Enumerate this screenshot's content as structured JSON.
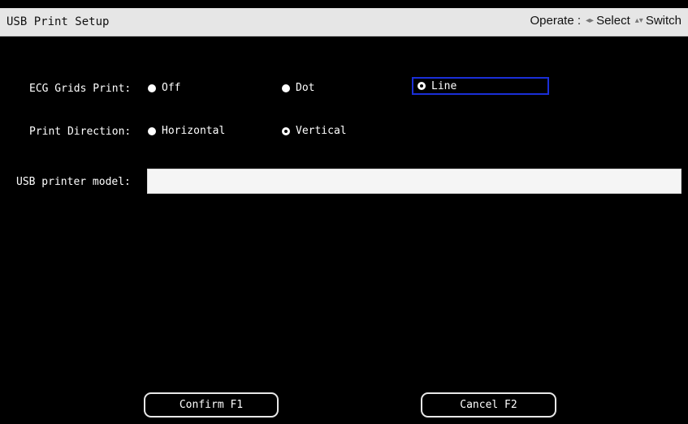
{
  "window": {
    "title": "USB Print Setup",
    "operate_label": "Operate :",
    "select_icon": "left-right-arrows-icon",
    "select_label": "Select",
    "switch_icon": "up-down-arrows-icon",
    "switch_label": "Switch"
  },
  "ecg_grids": {
    "label": "ECG Grids Print:",
    "options": [
      "Off",
      "Dot",
      "Line"
    ],
    "selected": "Line"
  },
  "print_direction": {
    "label": "Print Direction:",
    "options": [
      "Horizontal",
      "Vertical"
    ],
    "selected": "Vertical"
  },
  "usb_model": {
    "label": "USB printer model:",
    "value": ""
  },
  "buttons": {
    "confirm": "Confirm F1",
    "cancel": "Cancel F2"
  },
  "colors": {
    "background": "#000000",
    "titlebar": "#e6e6e6",
    "focus_outline": "#1a2fd8",
    "text": "#ffffff"
  }
}
